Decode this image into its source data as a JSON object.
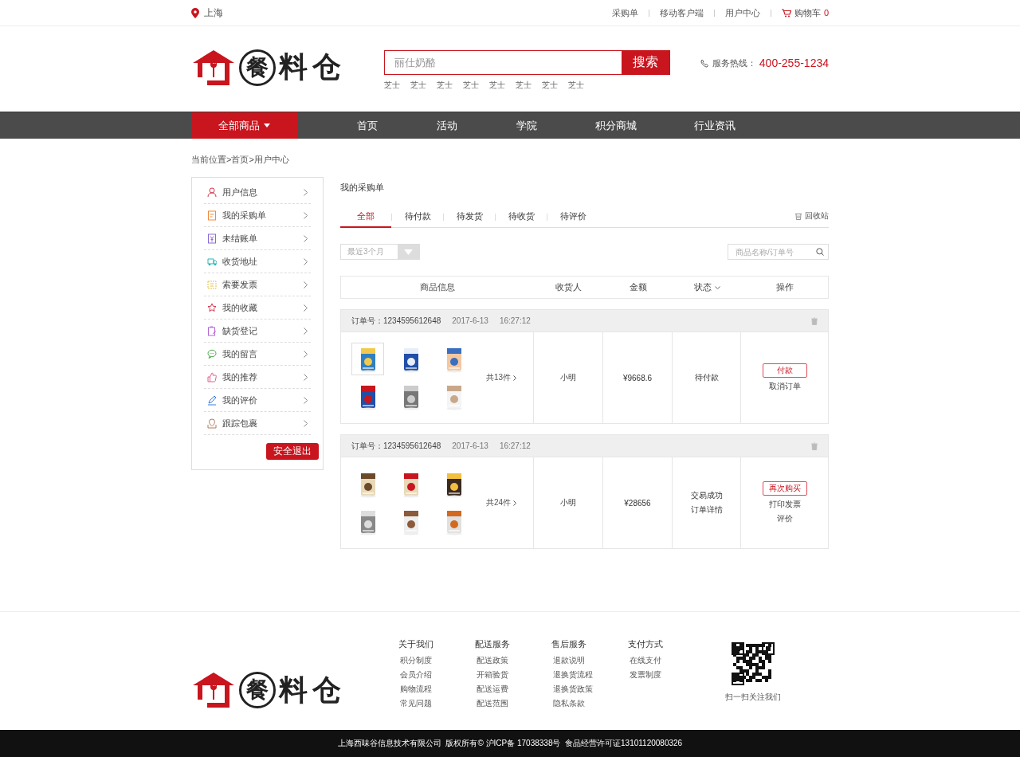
{
  "top_bar": {
    "location": "上海",
    "links": [
      "采购单",
      "移动客户端",
      "用户中心"
    ],
    "cart": {
      "label": "购物车",
      "count": "0"
    }
  },
  "header": {
    "logo": {
      "badge": "餐",
      "text": "料仓"
    },
    "search": {
      "placeholder": "丽仕奶酪",
      "button": "搜索"
    },
    "hot_words": [
      "芝士",
      "芝士",
      "芝士",
      "芝士",
      "芝士",
      "芝士",
      "芝士",
      "芝士"
    ],
    "hotline": {
      "label": "服务热线：",
      "number": "400-255-1234"
    }
  },
  "nav": {
    "category_button": "全部商品",
    "items": [
      {
        "label": "首页"
      },
      {
        "label": "活动"
      },
      {
        "label": "学院"
      },
      {
        "label": "积分商城"
      },
      {
        "label": "行业资讯"
      }
    ]
  },
  "breadcrumb": "当前位置>首页>用户中心",
  "sidebar": {
    "items": [
      {
        "label": "用户信息"
      },
      {
        "label": "我的采购单"
      },
      {
        "label": "未结账单"
      },
      {
        "label": "收货地址"
      },
      {
        "label": "索要发票"
      },
      {
        "label": "我的收藏"
      },
      {
        "label": "缺货登记"
      },
      {
        "label": "我的留言"
      },
      {
        "label": "我的推荐"
      },
      {
        "label": "我的评价"
      },
      {
        "label": "跟踪包裹"
      }
    ],
    "logout_button": "安全退出"
  },
  "main": {
    "title": "我的采购单",
    "tabs": [
      {
        "label": "全部",
        "selected": true
      },
      {
        "label": "待付款",
        "selected": false
      },
      {
        "label": "待发货",
        "selected": false
      },
      {
        "label": "待收货",
        "selected": false
      },
      {
        "label": "待评价",
        "selected": false
      }
    ],
    "recycle_bin": "回收站",
    "period_select": {
      "value": "最近3个月"
    },
    "search": {
      "placeholder": "商品名称/订单号"
    },
    "columns": [
      {
        "label": "商品信息",
        "dropdown": false
      },
      {
        "label": "收货人",
        "dropdown": false
      },
      {
        "label": "金额",
        "dropdown": false
      },
      {
        "label": "状态",
        "dropdown": true
      },
      {
        "label": "操作",
        "dropdown": false
      }
    ],
    "orders": [
      {
        "order_no_label": "订单号：",
        "order_no": "1234595612648",
        "date": "2017-6-13",
        "time": "16:27:12",
        "thumbnails": [
          {
            "kind": "picture",
            "selected": true
          },
          {
            "kind": "picture",
            "selected": false
          },
          {
            "kind": "picture",
            "selected": false
          },
          {
            "kind": "picture",
            "selected": false
          },
          {
            "kind": "picture",
            "selected": false
          },
          {
            "kind": "picture",
            "selected": false
          }
        ],
        "count": "共13件",
        "receiver": "小明",
        "amount": "¥9668.6",
        "status": [
          "待付款"
        ],
        "primary_action": "付款",
        "actions": [
          "取消订单"
        ]
      },
      {
        "order_no_label": "订单号：",
        "order_no": "1234595612648",
        "date": "2017-6-13",
        "time": "16:27:12",
        "thumbnails": [
          {
            "kind": "picture",
            "selected": false
          },
          {
            "kind": "picture",
            "selected": false
          },
          {
            "kind": "picture",
            "selected": false
          },
          {
            "kind": "picture",
            "selected": false
          },
          {
            "kind": "picture",
            "selected": false
          },
          {
            "kind": "picture",
            "selected": false
          }
        ],
        "count": "共24件",
        "receiver": "小明",
        "amount": "¥28656",
        "status": [
          "交易成功",
          "订单详情"
        ],
        "primary_action": "再次购买",
        "actions": [
          "打印发票",
          "评价"
        ]
      }
    ]
  },
  "footer": {
    "logo": {
      "badge": "餐",
      "text": "料仓"
    },
    "columns": [
      {
        "title": "关于我们",
        "links": [
          "积分制度",
          "会员介绍",
          "购物流程",
          "常见问题"
        ]
      },
      {
        "title": "配送服务",
        "links": [
          "配送政策",
          "开箱验货",
          "配送运费",
          "配送范围"
        ]
      },
      {
        "title": "售后服务",
        "links": [
          "退款说明",
          "退换货流程",
          "退换货政策",
          "隐私条款"
        ]
      },
      {
        "title": "支付方式",
        "links": [
          "在线支付",
          "发票制度"
        ]
      }
    ],
    "qr_caption": "扫一扫关注我们",
    "copyright": "上海西味谷信息技术有限公司  版权所有© 沪ICP备 17038338号  食品经营许可证13101120080326"
  }
}
